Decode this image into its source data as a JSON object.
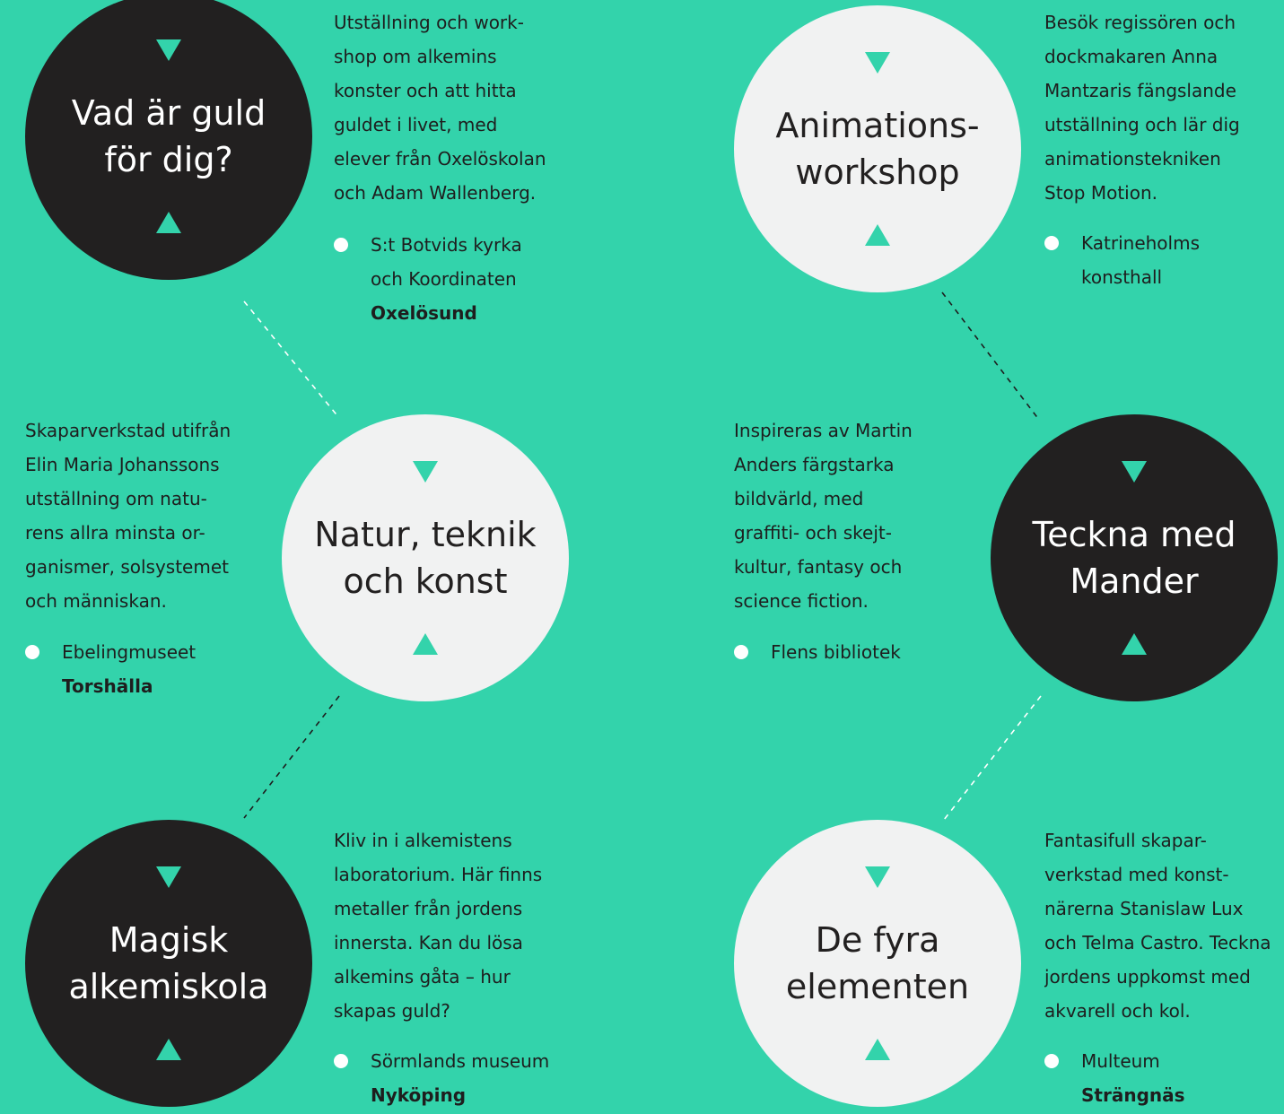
{
  "events": [
    {
      "title": [
        "Vad är guld",
        "för dig?"
      ],
      "description": [
        "Utställning och work-",
        "shop om alkemins",
        "konster och att hitta",
        "guldet i livet, med",
        "elever från Oxelöskolan",
        "och Adam Wallenberg."
      ],
      "venue": [
        "S:t Botvids kyrka",
        "och Koordinaten"
      ],
      "town": "Oxelösund"
    },
    {
      "title": [
        "Natur, teknik",
        "och konst"
      ],
      "description": [
        "Skaparverkstad utifrån",
        "Elin Maria Johanssons",
        "utställning om natu-",
        "rens allra minsta or-",
        "ganismer, solsystemet",
        "och människan."
      ],
      "venue": [
        "Ebelingmuseet"
      ],
      "town": "Torshälla"
    },
    {
      "title": [
        "Magisk",
        "alkemiskola"
      ],
      "description": [
        "Kliv in i alkemistens",
        "laboratorium. Här finns",
        "metaller från jordens",
        "innersta. Kan du lösa",
        "alkemins gåta – hur",
        "skapas guld?"
      ],
      "venue": [
        "Sörmlands museum"
      ],
      "town": "Nyköping"
    },
    {
      "title": [
        "Animations-",
        "workshop"
      ],
      "description": [
        "Besök regissören och",
        "dockmakaren Anna",
        "Mantzaris fängslande",
        "utställning och lär dig",
        "animationstekniken",
        "Stop Motion."
      ],
      "venue": [
        "Katrineholms",
        "konsthall"
      ],
      "town": ""
    },
    {
      "title": [
        "Teckna med",
        "Mander"
      ],
      "description": [
        "Inspireras av Martin",
        "Anders färgstarka",
        "bildvärld, med",
        "graffiti- och skejt-",
        "kultur, fantasy och",
        "science fiction."
      ],
      "venue": [
        "Flens bibliotek"
      ],
      "town": ""
    },
    {
      "title": [
        "De fyra",
        "elementen"
      ],
      "description": [
        "Fantasifull skapar-",
        "verkstad med konst-",
        "närerna Stanislaw Lux",
        "och Telma Castro. Teckna",
        "jordens uppkomst med",
        "akvarell och kol."
      ],
      "venue": [
        "Multeum"
      ],
      "town": "Strängnäs"
    }
  ],
  "colors": {
    "background": "#33d3ab",
    "dark": "#222020",
    "light": "#f1f2f2"
  }
}
